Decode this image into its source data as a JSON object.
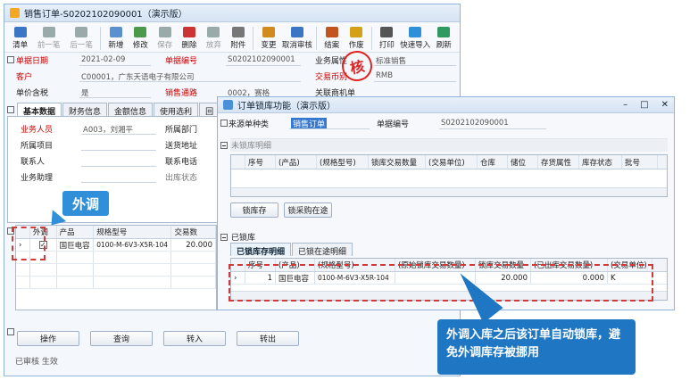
{
  "main": {
    "title": "销售订单-S0202102090001（演示版）",
    "toolbar": [
      {
        "label": "清单",
        "icon": "list-icon",
        "enabled": true
      },
      {
        "label": "前一笔",
        "icon": "arrow-left-icon",
        "enabled": false
      },
      {
        "label": "后一笔",
        "icon": "arrow-right-icon",
        "enabled": false
      },
      {
        "label": "新增",
        "icon": "new-doc-icon",
        "enabled": true
      },
      {
        "label": "修改",
        "icon": "edit-icon",
        "enabled": true
      },
      {
        "label": "保存",
        "icon": "save-icon",
        "enabled": false
      },
      {
        "label": "删除",
        "icon": "delete-icon",
        "enabled": true
      },
      {
        "label": "放弃",
        "icon": "discard-icon",
        "enabled": false
      },
      {
        "label": "附件",
        "icon": "attachment-icon",
        "enabled": true
      },
      {
        "label": "变更",
        "icon": "change-icon",
        "enabled": true
      },
      {
        "label": "取消审核",
        "icon": "unaudit-icon",
        "enabled": true
      },
      {
        "label": "结案",
        "icon": "close-case-icon",
        "enabled": true
      },
      {
        "label": "作废",
        "icon": "void-icon",
        "enabled": true
      },
      {
        "label": "打印",
        "icon": "print-icon",
        "enabled": true
      },
      {
        "label": "快速导入",
        "icon": "import-icon",
        "enabled": true
      },
      {
        "label": "刷新",
        "icon": "refresh-icon",
        "enabled": true
      }
    ],
    "header": {
      "date_label": "单据日期",
      "date_value": "2021-02-09",
      "no_label": "单据编号",
      "no_value": "S0202102090001",
      "biz_label": "业务属性",
      "biz_value": "标准销售",
      "cust_label": "客户",
      "cust_value": "C00001，广东天语电子有限公司",
      "currency_label": "交易币别",
      "currency_value": "RMB",
      "tax_label": "单价含税",
      "tax_value": "是",
      "channel_label": "销售通路",
      "channel_value": "0002，赛格",
      "related_label": "关联商机单"
    },
    "tabs": [
      "基本数据",
      "财务信息",
      "金额信息",
      "使用选利",
      "回"
    ],
    "basic": {
      "sales_label": "业务人员",
      "sales_value": "A003，刘湘平",
      "dept_label": "所属部门",
      "project_label": "所属项目",
      "addr_label": "送货地址",
      "contact_label": "联系人",
      "phone_label": "联系电话",
      "assistant_label": "业务助理",
      "status_label": "出库状态"
    },
    "grid": {
      "headers": [
        "外调",
        "产品",
        "规格型号",
        "交易数"
      ],
      "rows": [
        {
          "checked": true,
          "product": "国巨电容",
          "spec": "0100-M-6V3-X5R-104",
          "qty": "20.000"
        }
      ]
    },
    "buttons": [
      "操作",
      "查询",
      "转入",
      "转出"
    ],
    "status": "已审核 生效",
    "stamp": "核"
  },
  "lock": {
    "title": "订单锁库功能（演示版）",
    "source_label": "来源单种类",
    "source_value": "销售订单",
    "doc_label": "单据编号",
    "doc_value": "S0202102090001",
    "unlocked_title": "未锁库明细",
    "unlocked_headers": [
      "序号",
      "(产品)",
      "(规格型号)",
      "锁库交易数量",
      "(交易单位)",
      "仓库",
      "储位",
      "存货属性",
      "库存状态",
      "批号"
    ],
    "lock_btn": "锁库存",
    "lock_po_btn": "锁采购在途",
    "locked_title": "已锁库",
    "locked_tabs": [
      "已锁库存明细",
      "已锁在途明细"
    ],
    "locked_headers": [
      "序号",
      "(产品)",
      "(规格型号)",
      "(原始锁库交易数量)",
      "锁库交易数量",
      "(已出库交易数量)",
      "(交易单位)"
    ],
    "locked_rows": [
      {
        "seq": "1",
        "product": "国巨电容",
        "spec": "0100-M-6V3-X5R-104",
        "qty": "20.000",
        "out": "0.000",
        "unit": "K"
      }
    ]
  },
  "callouts": {
    "outsource": "外调",
    "note": "外调入库之后该订单自动锁库，避免外调库存被挪用"
  },
  "colors": {
    "accent_blue": "#2f8fd8",
    "callout_bg": "#1f77c4",
    "dash_red": "#d23a3a",
    "required_red": "#cc0000"
  }
}
